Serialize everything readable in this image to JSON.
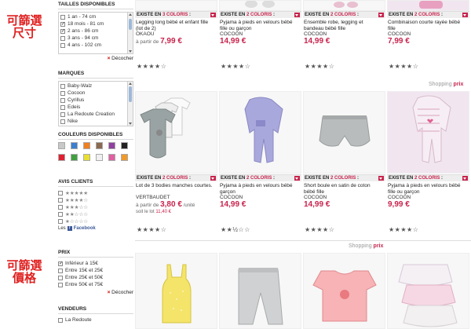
{
  "annotations": {
    "size": [
      "可篩選",
      "尺寸"
    ],
    "price": [
      "可篩選",
      "價格"
    ]
  },
  "filters": {
    "sizes": {
      "title": "TAILLES DISPONIBLES",
      "items": [
        {
          "label": "1 an - 74 cm",
          "checked": false
        },
        {
          "label": "18 mois - 81 cm",
          "checked": true
        },
        {
          "label": "2 ans - 86 cm",
          "checked": true
        },
        {
          "label": "3 ans - 94 cm",
          "checked": false
        },
        {
          "label": "4 ans - 102 cm",
          "checked": false
        }
      ],
      "clear": "Décocher"
    },
    "brands": {
      "title": "MARQUES",
      "items": [
        "Baby-Walz",
        "Cocoon",
        "Cyrillus",
        "Edeis",
        "La Redoute Creation",
        "Nike"
      ]
    },
    "colors": {
      "title": "COULEURS DISPONIBLES",
      "swatches": [
        "#c8c8c8",
        "#3a7fd0",
        "#f08020",
        "#8a6a50",
        "#9040a0",
        "#222222",
        "#e02030",
        "#40a040",
        "#e8e030",
        "#f0f0f0",
        "#e060a0",
        "#f09a2a"
      ]
    },
    "reviews": {
      "title": "AVIS CLIENTS",
      "levels": [
        5,
        4,
        3,
        2,
        1
      ],
      "facebook": "Les",
      "facebook_brand": "Facebook"
    },
    "price": {
      "title": "PRIX",
      "items": [
        {
          "label": "Inférieur à 15€",
          "checked": true
        },
        {
          "label": "Entre 15€ et 25€",
          "checked": false
        },
        {
          "label": "Entre 25€ et 50€",
          "checked": false
        },
        {
          "label": "Entre 50€ et 75€",
          "checked": false
        }
      ],
      "clear": "Décocher"
    },
    "sellers": {
      "title": "VENDEURS",
      "items": [
        "La Redoute"
      ]
    }
  },
  "products_row1": [
    {
      "existe": "EXISTE EN",
      "n": "3 COLORIS",
      "name": "Legging long bébé et enfant fille (lot de 2)",
      "brand": "OKAOU",
      "from": "à partir de",
      "price": "7,99 €",
      "rating": "★★★★☆"
    },
    {
      "existe": "EXISTE EN",
      "n": "2 COLORIS",
      "name": "Pyjama à pieds en velours bébé fille ou garçon",
      "brand": "COCOON",
      "price": "14,99 €",
      "rating": "★★★★☆"
    },
    {
      "existe": "EXISTE EN",
      "n": "2 COLORIS",
      "name": "Ensemble robe, legging et bandeau bébé fille",
      "brand": "COCOON",
      "price": "14,99 €",
      "rating": "★★★★☆"
    },
    {
      "existe": "EXISTE EN",
      "n": "2 COLORIS",
      "name": "Combinaison courte rayée bébé fille",
      "brand": "COCOON",
      "price": "7,99 €",
      "rating": "★★★★☆"
    }
  ],
  "shopping": {
    "prefix": "Shopping",
    "suffix": "prix"
  },
  "products_row2": [
    {
      "existe": "EXISTE EN",
      "n": "2 COLORIS",
      "name": "Lot de 3 bodies manches courtes.",
      "brand": "VERTBAUDET",
      "from": "à partir de",
      "price": "3,80 €",
      "unit": "/unité",
      "total": "soit le lot",
      "total_price": "11,40 €",
      "rating": "★★★★☆"
    },
    {
      "existe": "EXISTE EN",
      "n": "2 COLORIS",
      "name": "Pyjama à pieds en velours bébé garçon",
      "brand": "COCOON",
      "price": "14,99 €",
      "rating": "★★½☆☆"
    },
    {
      "existe": "EXISTE EN",
      "n": "2 COLORIS",
      "name": "Short boule en satin de coton bébé fille",
      "brand": "COCOON",
      "price": "14,99 €",
      "rating": "★★★★☆"
    },
    {
      "existe": "EXISTE EN",
      "n": "2 COLORIS",
      "name": "Pyjama à pieds en velours bébé fille ou garçon",
      "brand": "COCOON",
      "price": "9,99 €",
      "rating": "★★★★☆"
    }
  ]
}
